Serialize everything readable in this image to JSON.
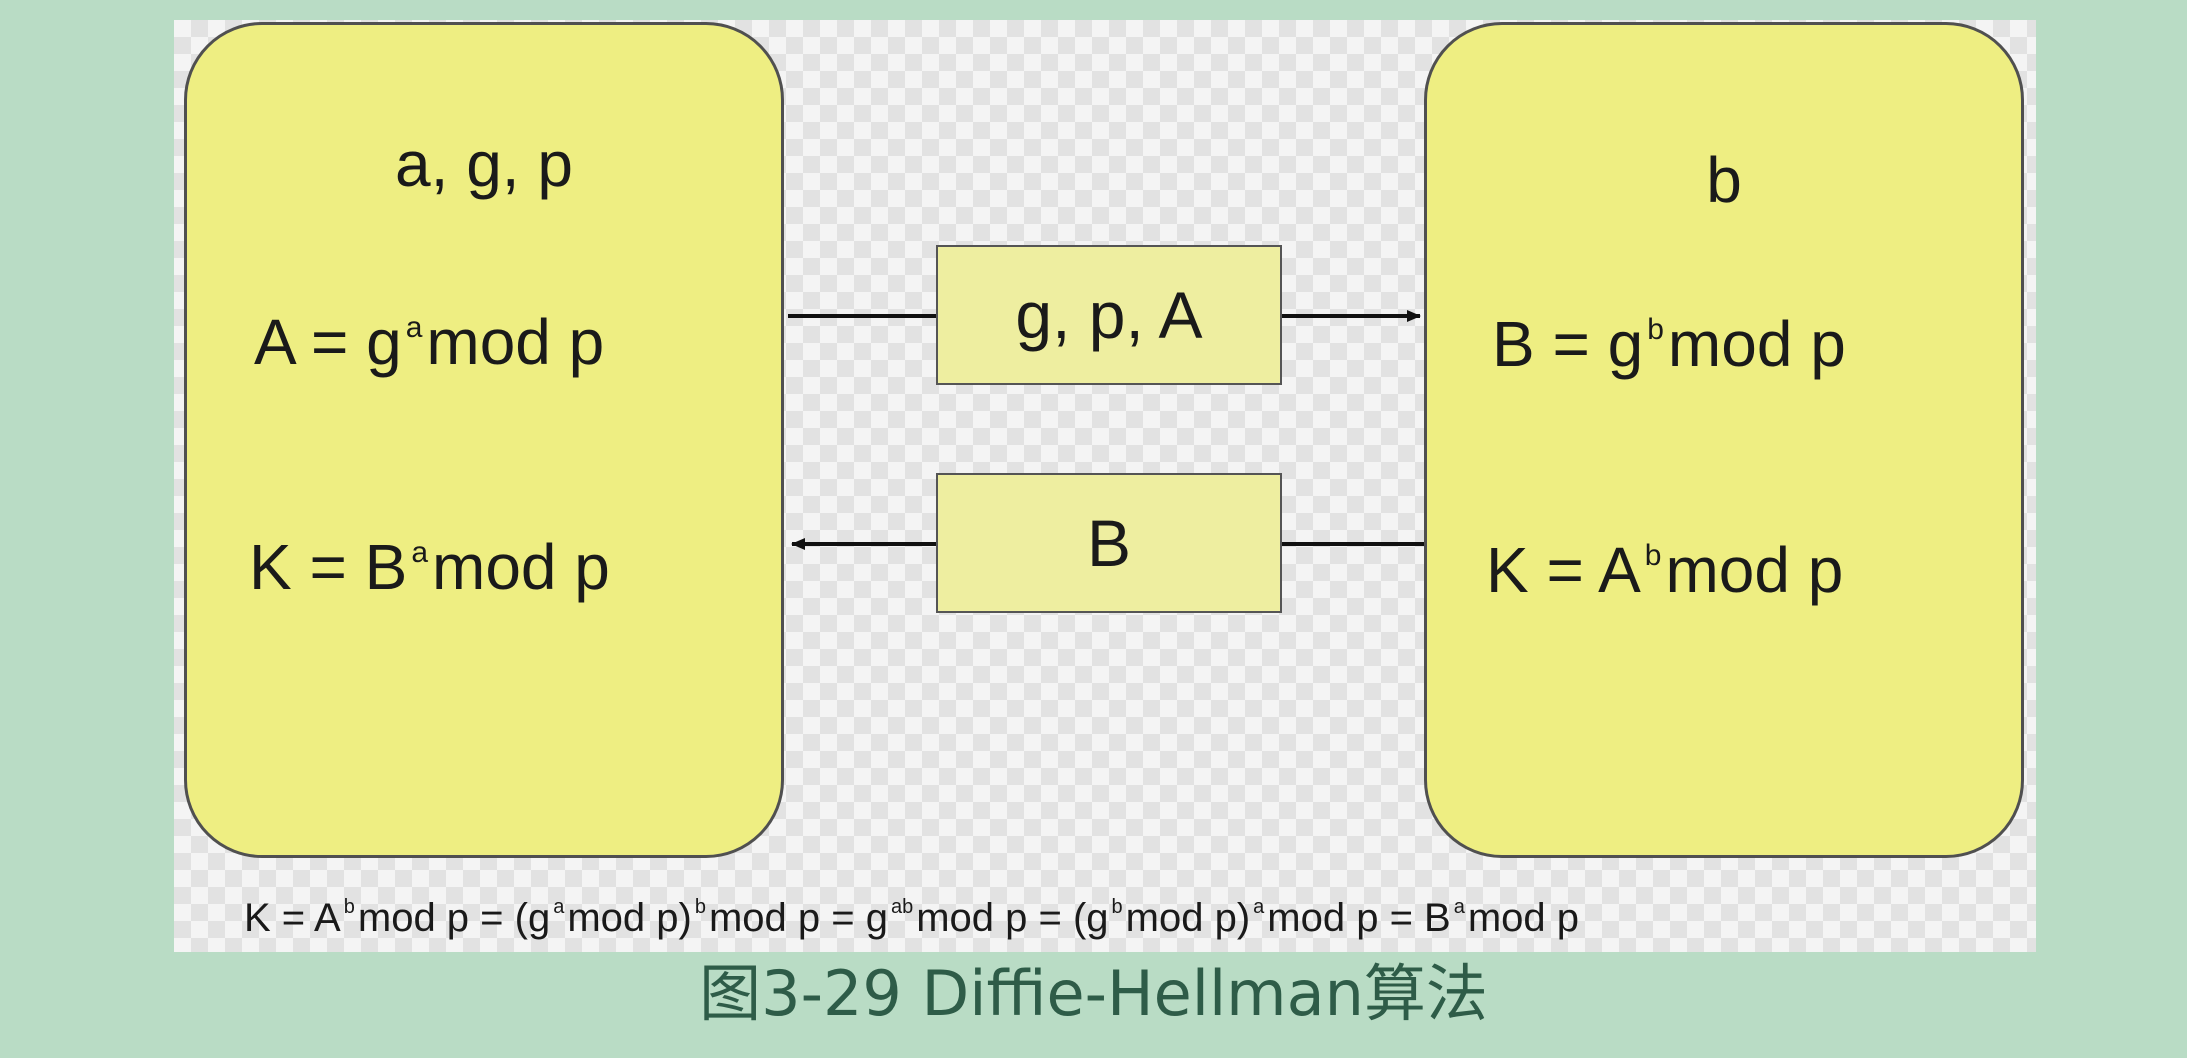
{
  "alice": {
    "params": "a, g, p",
    "public_key": {
      "lhs": "A",
      "eq": "=",
      "base": "g",
      "exp": "a",
      "tail": "mod p"
    },
    "shared_key": {
      "lhs": "K",
      "eq": "=",
      "base": "B",
      "exp": "a",
      "tail": "mod p"
    }
  },
  "bob": {
    "params": "b",
    "public_key": {
      "lhs": "B",
      "eq": "=",
      "base": "g",
      "exp": "b",
      "tail": "mod p"
    },
    "shared_key": {
      "lhs": "K",
      "eq": "=",
      "base": "A",
      "exp": "b",
      "tail": "mod p"
    }
  },
  "messages": {
    "to_bob": "g, p, A",
    "to_alice": "B"
  },
  "derivation": {
    "p1": "K = A",
    "e1": "b",
    "p2": "mod p = (g",
    "e2": "a",
    "p3": "mod p)",
    "e3": "b",
    "p4": "mod p = g",
    "e4": "ab",
    "p5": "mod p = (g",
    "e5": "b",
    "p6": "mod p)",
    "e6": "a",
    "p7": "mod p = B",
    "e7": "a",
    "p8": "mod p"
  },
  "caption": "图3-29 Diffie-Hellman算法",
  "colors": {
    "page_background": "#b9dcc5",
    "party_box_fill": "#eeee82",
    "message_box_fill": "#eeeea0",
    "caption_text": "#2e5c48"
  }
}
